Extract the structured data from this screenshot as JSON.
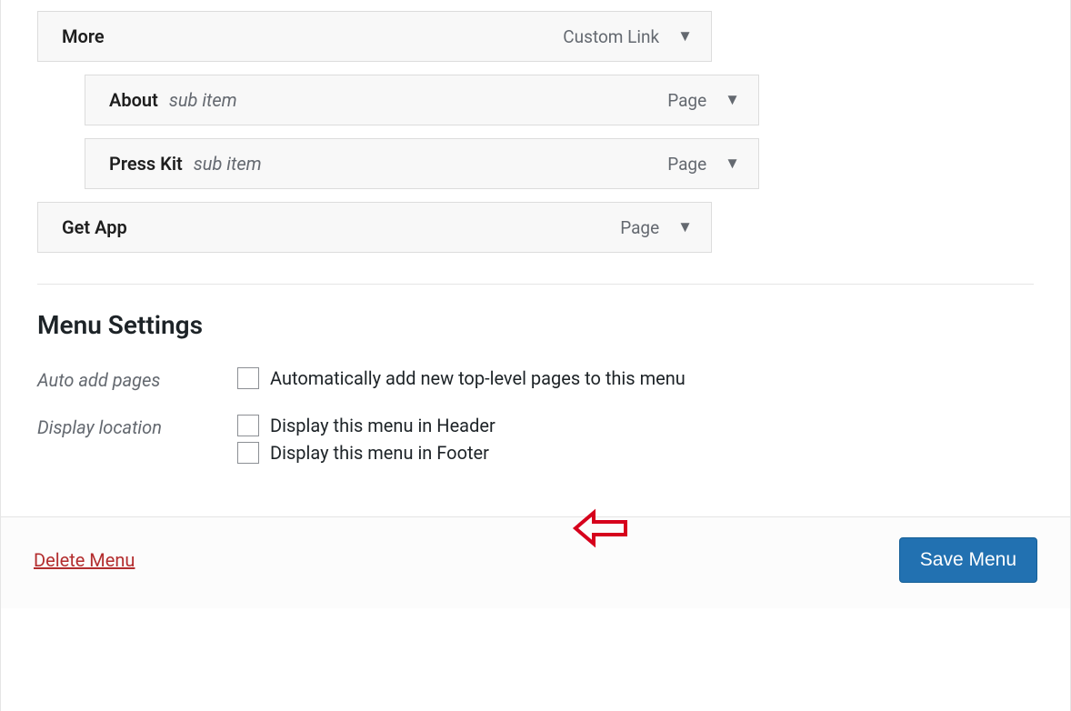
{
  "menuItems": [
    {
      "title": "More",
      "subtitle": "",
      "type": "Custom Link",
      "indent": false
    },
    {
      "title": "About",
      "subtitle": "sub item",
      "type": "Page",
      "indent": true
    },
    {
      "title": "Press Kit",
      "subtitle": "sub item",
      "type": "Page",
      "indent": true
    },
    {
      "title": "Get App",
      "subtitle": "",
      "type": "Page",
      "indent": false
    }
  ],
  "settings": {
    "heading": "Menu Settings",
    "autoAdd": {
      "label": "Auto add pages",
      "checkbox_label": "Automatically add new top-level pages to this menu"
    },
    "displayLocation": {
      "label": "Display location",
      "options": [
        "Display this menu in Header",
        "Display this menu in Footer"
      ]
    }
  },
  "footer": {
    "delete_label": "Delete Menu",
    "save_label": "Save Menu"
  }
}
